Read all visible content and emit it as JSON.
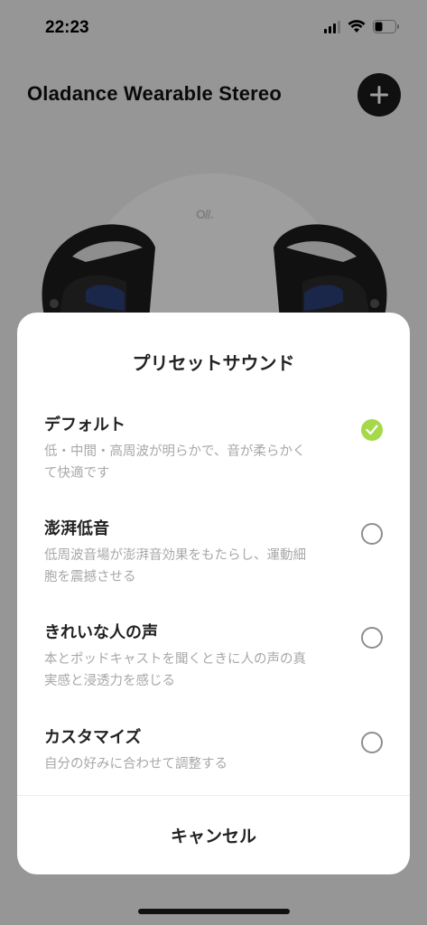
{
  "status_bar": {
    "time": "22:23"
  },
  "header": {
    "title": "Oladance Wearable Stereo",
    "add_icon": "plus-icon"
  },
  "device": {
    "brand_logo": "O//.",
    "image": "earbuds"
  },
  "sheet": {
    "title": "プリセットサウンド",
    "options": [
      {
        "title": "デフォルト",
        "desc_line1": "低・中間・高周波が明らかで、音が柔らかく",
        "desc_line2": "て快適です",
        "selected": true
      },
      {
        "title": "澎湃低音",
        "desc_line1": "低周波音場が澎湃音効果をもたらし、運動細",
        "desc_line2": "胞を震撼させる",
        "selected": false
      },
      {
        "title": "きれいな人の声",
        "desc_line1": "本とポッドキャストを聞くときに人の声の真",
        "desc_line2": "実感と浸透力を感じる",
        "selected": false
      },
      {
        "title": "カスタマイズ",
        "desc_line1": "自分の好みに合わせて調整する",
        "desc_line2": "",
        "selected": false
      }
    ],
    "cancel_label": "キャンセル"
  },
  "colors": {
    "accent_check": "#a5d94a",
    "overlay": "rgba(0,0,0,0.38)"
  }
}
